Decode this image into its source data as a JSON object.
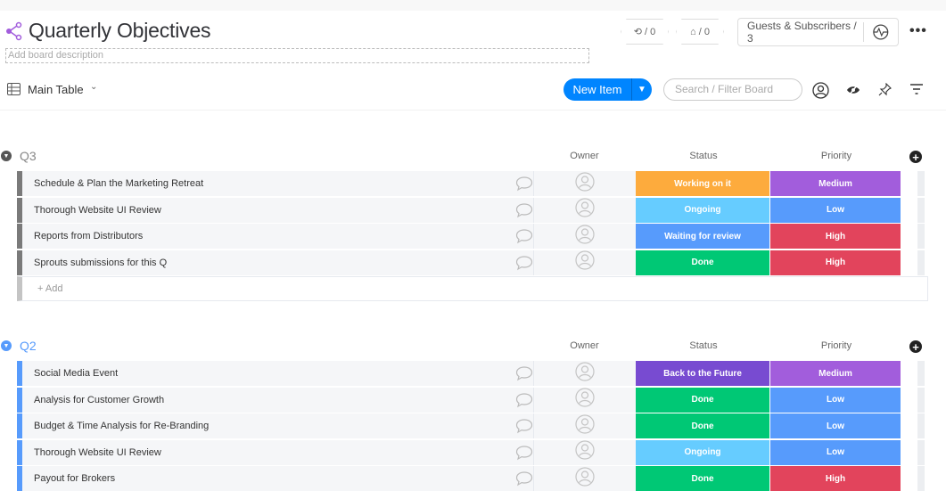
{
  "board": {
    "title": "Quarterly Objectives",
    "description_placeholder": "Add board description"
  },
  "header": {
    "integrations_count": "/ 0",
    "automations_count": "/ 0",
    "guests_label": "Guests & Subscribers / 3",
    "more": "•••"
  },
  "toolbar": {
    "view_label": "Main Table",
    "new_item_label": "New Item",
    "search_placeholder": "Search / Filter Board"
  },
  "columns": {
    "owner": "Owner",
    "status": "Status",
    "priority": "Priority"
  },
  "colors": {
    "orange": "#fdab3d",
    "purple": "#a25ddc",
    "sky": "#66ccff",
    "blue": "#579bfc",
    "red": "#e2445c",
    "green": "#00c875",
    "dark_purple": "#784bd1",
    "q3_group": "#7a7a7a",
    "q2_group": "#579bfc",
    "accent": "#0085ff"
  },
  "groups": [
    {
      "title": "Q3",
      "color": "#7a7a7a",
      "add_label": "+ Add",
      "items": [
        {
          "name": "Schedule & Plan the Marketing Retreat",
          "status": "Working on it",
          "status_color": "#fdab3d",
          "priority": "Medium",
          "priority_color": "#a25ddc"
        },
        {
          "name": "Thorough Website UI Review",
          "status": "Ongoing",
          "status_color": "#66ccff",
          "priority": "Low",
          "priority_color": "#579bfc"
        },
        {
          "name": "Reports from Distributors",
          "status": "Waiting for review",
          "status_color": "#579bfc",
          "priority": "High",
          "priority_color": "#e2445c"
        },
        {
          "name": "Sprouts submissions for this Q",
          "status": "Done",
          "status_color": "#00c875",
          "priority": "High",
          "priority_color": "#e2445c"
        }
      ]
    },
    {
      "title": "Q2",
      "color": "#579bfc",
      "items": [
        {
          "name": "Social Media Event",
          "status": "Back to the Future",
          "status_color": "#784bd1",
          "priority": "Medium",
          "priority_color": "#a25ddc"
        },
        {
          "name": "Analysis for Customer Growth",
          "status": "Done",
          "status_color": "#00c875",
          "priority": "Low",
          "priority_color": "#579bfc"
        },
        {
          "name": "Budget & Time Analysis for Re-Branding",
          "status": "Done",
          "status_color": "#00c875",
          "priority": "Low",
          "priority_color": "#579bfc"
        },
        {
          "name": "Thorough Website UI Review",
          "status": "Ongoing",
          "status_color": "#66ccff",
          "priority": "Low",
          "priority_color": "#579bfc"
        },
        {
          "name": "Payout for Brokers",
          "status": "Done",
          "status_color": "#00c875",
          "priority": "High",
          "priority_color": "#e2445c"
        }
      ]
    }
  ]
}
